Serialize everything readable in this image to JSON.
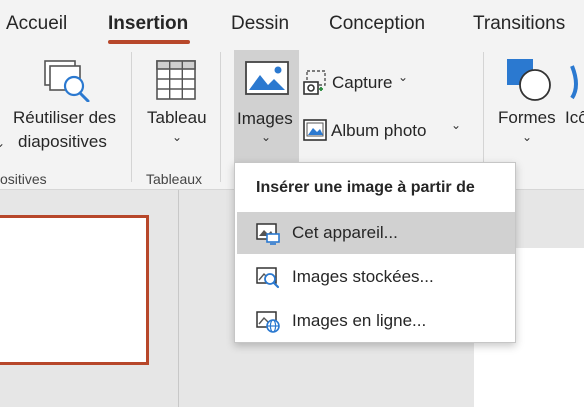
{
  "tabs": [
    {
      "label": "Accueil",
      "active": false
    },
    {
      "label": "Insertion",
      "active": true
    },
    {
      "label": "Dessin",
      "active": false
    },
    {
      "label": "Conception",
      "active": false
    },
    {
      "label": "Transitions",
      "active": false
    }
  ],
  "colors": {
    "accent": "#b7472a",
    "ribbon_bg": "#f3f3f3",
    "selected_bg": "#d1d1d1",
    "icon_blue": "#2b79d0"
  },
  "ribbon": {
    "reuse": {
      "label_line1": "Réutiliser des",
      "label_line2": "diapositives",
      "icon": "reuse-slides-icon"
    },
    "reuse_group_label": "ositives",
    "tableau": {
      "label": "Tableau",
      "icon": "table-icon",
      "group_label": "Tableaux"
    },
    "images": {
      "label": "Images",
      "icon": "picture-icon"
    },
    "capture": {
      "label": "Capture",
      "icon": "screenshot-icon"
    },
    "album": {
      "label": "Album photo",
      "icon": "photo-album-icon"
    },
    "formes": {
      "label": "Formes",
      "icon": "shapes-icon"
    },
    "icones": {
      "label": "Icô",
      "icon": "icons-icon"
    }
  },
  "dropdown": {
    "header": "Insérer une image à partir de",
    "items": [
      {
        "label": "Cet appareil...",
        "icon": "device-picture-icon",
        "highlighted": true
      },
      {
        "label": "Images stockées...",
        "icon": "stock-images-icon",
        "highlighted": false
      },
      {
        "label": "Images en ligne...",
        "icon": "online-pictures-icon",
        "highlighted": false
      }
    ]
  }
}
